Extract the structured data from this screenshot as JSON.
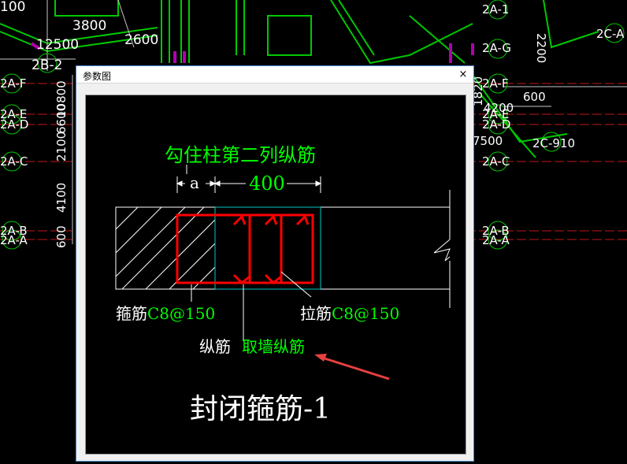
{
  "dialog": {
    "title": "参数图",
    "close_label": "×"
  },
  "detail": {
    "top_note": "勾住柱第二列纵筋",
    "dim_a": "a",
    "dim_400": "400",
    "stirrup_label_prefix": "箍筋",
    "stirrup_label_value": "C8@150",
    "tie_label_prefix": "拉筋",
    "tie_label_value": "C8@150",
    "long_label_prefix": "纵筋 ",
    "long_label_value": "取墙纵筋",
    "caption": "封闭箍筋-1"
  },
  "background": {
    "dimensions": [
      "100",
      "3800",
      "2600",
      "12500",
      "10800",
      "6600",
      "2100",
      "4100",
      "600",
      "2200",
      "600",
      "4200",
      "7500",
      "1820"
    ],
    "axes": [
      "2B-2",
      "2A-F",
      "2A-E",
      "2A-D",
      "2A-C",
      "2A-B",
      "2A-A",
      "2A-G",
      "2A-1",
      "2C-A",
      "2A-F",
      "2A-E",
      "2A-D",
      "2A-C",
      "2A-B",
      "2A-A",
      "2C-910"
    ]
  },
  "colors": {
    "green_text": "#00ff00",
    "rebar": "#ff0000",
    "white": "#ffffff",
    "cyan": "#00c8c8",
    "arrow": "#e84040",
    "dialog_border": "#4a86c8"
  }
}
